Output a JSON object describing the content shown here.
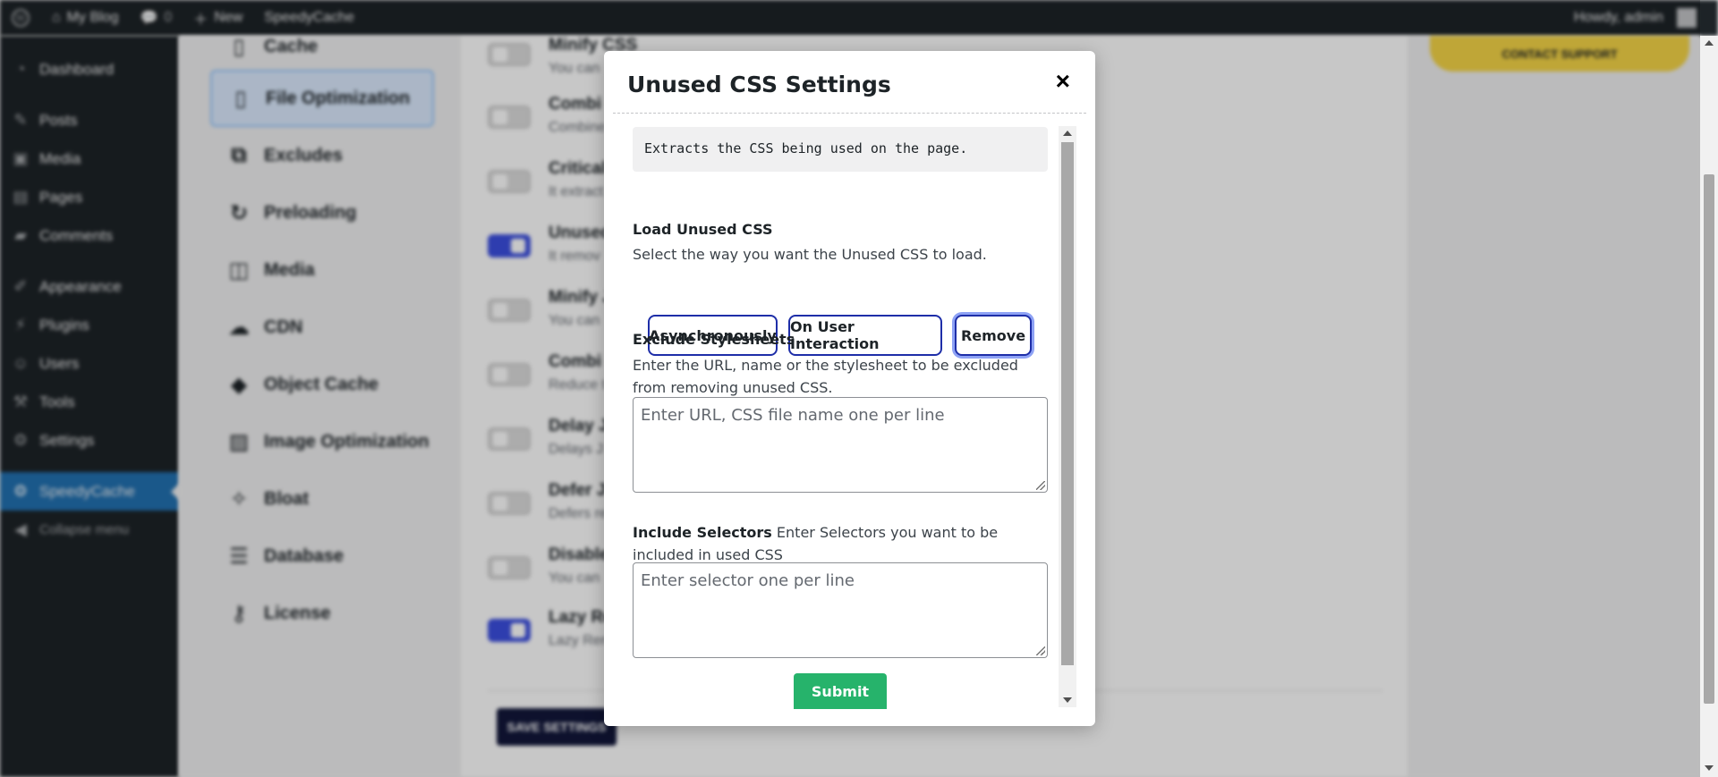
{
  "adminbar": {
    "site_name": "My Blog",
    "comments_count": "0",
    "new_label": "New",
    "plugin_label": "SpeedyCache",
    "howdy": "Howdy, admin"
  },
  "sidebar": {
    "items": [
      {
        "label": "Dashboard",
        "icon": "dashboard-icon"
      },
      {
        "label": "Posts",
        "icon": "pin-icon"
      },
      {
        "label": "Media",
        "icon": "media-icon"
      },
      {
        "label": "Pages",
        "icon": "page-icon"
      },
      {
        "label": "Comments",
        "icon": "comment-icon"
      },
      {
        "label": "Appearance",
        "icon": "brush-icon"
      },
      {
        "label": "Plugins",
        "icon": "plug-icon"
      },
      {
        "label": "Users",
        "icon": "user-icon"
      },
      {
        "label": "Tools",
        "icon": "wrench-icon"
      },
      {
        "label": "Settings",
        "icon": "settings-icon"
      },
      {
        "label": "SpeedyCache",
        "icon": "speedycache-icon"
      },
      {
        "label": "Collapse menu",
        "icon": "collapse-icon"
      }
    ]
  },
  "plugin_nav": {
    "items": [
      {
        "label": "Cache",
        "icon": "file-icon"
      },
      {
        "label": "File Optimization",
        "icon": "file-icon"
      },
      {
        "label": "Excludes",
        "icon": "copy-icon"
      },
      {
        "label": "Preloading",
        "icon": "refresh-icon"
      },
      {
        "label": "Media",
        "icon": "media-icon"
      },
      {
        "label": "CDN",
        "icon": "cloud-icon"
      },
      {
        "label": "Object Cache",
        "icon": "cube-icon"
      },
      {
        "label": "Image Optimization",
        "icon": "image-icon"
      },
      {
        "label": "Bloat",
        "icon": "broom-icon"
      },
      {
        "label": "Database",
        "icon": "database-icon"
      },
      {
        "label": "License",
        "icon": "key-icon"
      }
    ]
  },
  "settings": {
    "rows": [
      {
        "title": "Minify CSS",
        "desc": "You can",
        "on": false
      },
      {
        "title": "Combi",
        "desc": "Combine",
        "on": false
      },
      {
        "title": "Critical",
        "desc": "It extract",
        "on": false
      },
      {
        "title": "Unused",
        "desc": "It remov",
        "on": true
      },
      {
        "title": "Minify J",
        "desc": "You can",
        "on": false
      },
      {
        "title": "Combi",
        "desc": "Reduce t",
        "on": false
      },
      {
        "title": "Delay J",
        "desc": "Delays J",
        "on": false
      },
      {
        "title": "Defer J",
        "desc": "Defers re",
        "on": false
      },
      {
        "title": "Disable",
        "desc": "You can",
        "on": false
      },
      {
        "title": "Lazy Re",
        "desc": "Lazy Ren",
        "on": true
      }
    ],
    "save_label": "SAVE SETTINGS",
    "contact_label": "CONTACT SUPPORT"
  },
  "modal": {
    "title": "Unused CSS Settings",
    "close_glyph": "×",
    "description": "Extracts the CSS being used on the page.",
    "load": {
      "label": "Load Unused CSS",
      "help": "Select the way you want the Unused CSS to load.",
      "options": [
        "Asynchronously",
        "On User Interaction",
        "Remove"
      ],
      "selected": "Remove"
    },
    "exclude": {
      "label": "Exclude Stylesheets",
      "help": "Enter the URL, name or the stylesheet to be excluded from removing unused CSS.",
      "placeholder": "Enter URL, CSS file name one per line"
    },
    "include": {
      "label": "Include Selectors",
      "help": "Enter Selectors you want to be included in used CSS",
      "placeholder": "Enter selector one per line"
    },
    "submit_label": "Submit"
  },
  "colors": {
    "accent": "#2271b1",
    "toggle_on": "#3c4fe0",
    "submit": "#26b36b",
    "option_border": "#1e2ea8"
  }
}
